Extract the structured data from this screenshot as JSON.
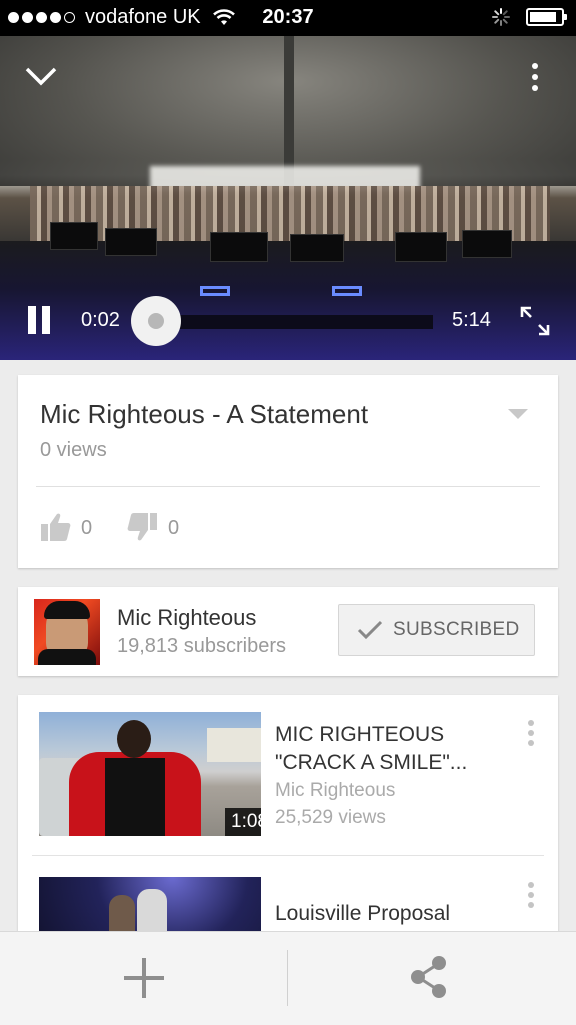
{
  "status_bar": {
    "carrier": "vodafone UK",
    "time": "20:37",
    "signal_bars": 4,
    "signal_total": 5
  },
  "player": {
    "current_time": "0:02",
    "duration": "5:14",
    "progress": 0.006,
    "icons": [
      "chevron-down-icon",
      "more-vert-icon",
      "pause-icon",
      "fullscreen-icon"
    ]
  },
  "video": {
    "title": "Mic Righteous - A Statement",
    "views": "0 views",
    "likes": "0",
    "dislikes": "0"
  },
  "channel": {
    "name": "Mic Righteous",
    "subscribers": "19,813 subscribers",
    "subscribe_label": "SUBSCRIBED"
  },
  "related": [
    {
      "title": "MIC RIGHTEOUS \"CRACK A SMILE\"...",
      "channel": "Mic Righteous",
      "views": "25,529 views",
      "duration": "1:08"
    },
    {
      "title": "Louisville Proposal"
    }
  ],
  "bottom_bar": {
    "icons": [
      "add-icon",
      "share-icon"
    ]
  },
  "colors": {
    "accent_text": "#333333",
    "muted_text": "#999999",
    "status_bar": "#000000",
    "page_bg": "#ececec"
  }
}
